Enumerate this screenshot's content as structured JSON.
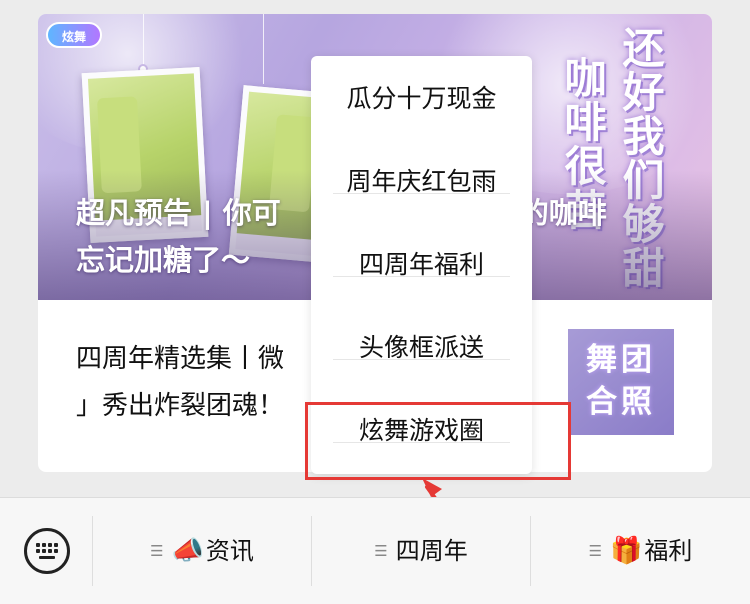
{
  "banner": {
    "logo_text": "炫舞",
    "title": "超凡预告 | 你可…我的咖啡忘记加糖了～",
    "title_line1": "超凡预告 | 你可",
    "title_line1_tail": "我的咖啡",
    "title_line2": "忘记加糖了～",
    "deco_text_right": "还好我们够甜",
    "deco_text_left": "咖啡很苦"
  },
  "article": {
    "line1": "四周年精选集丨微",
    "line2": "」秀出炸裂团魂！",
    "thumb_text": "舞团合照"
  },
  "menu": {
    "items": [
      {
        "label": "瓜分十万现金"
      },
      {
        "label": "周年庆红包雨"
      },
      {
        "label": "四周年福利"
      },
      {
        "label": "头像框派送"
      },
      {
        "label": "炫舞游戏圈"
      }
    ]
  },
  "tabbar": {
    "keyboard_icon": "keyboard-icon",
    "tabs": [
      {
        "label": "资讯",
        "icon": "megaphone-icon"
      },
      {
        "label": "四周年",
        "icon": ""
      },
      {
        "label": "福利",
        "icon": "gift-icon"
      }
    ]
  },
  "colors": {
    "highlight": "#e53935",
    "banner_purple": "#b6a6e0"
  }
}
